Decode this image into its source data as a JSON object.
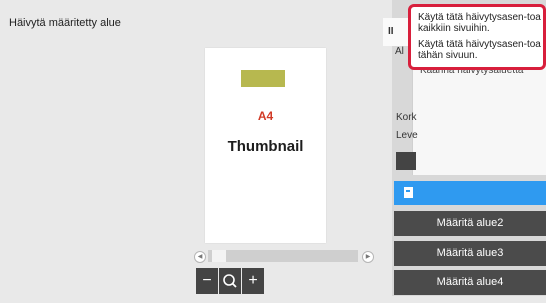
{
  "header": {
    "title": "Häivytä määritetty alue"
  },
  "preview": {
    "highlight_label": "A4",
    "page_label": "Thumbnail"
  },
  "scrollbar": {
    "left_arrow": "◀",
    "right_arrow": "▶"
  },
  "zoom": {
    "minus": "−",
    "search": "🔍",
    "plus": "+"
  },
  "right_panel": {
    "tab_fragment": "II",
    "side_fragment": "Al",
    "behind_item": "Käännä häivytysaluetta",
    "fragment_height": "Kork",
    "fragment_width": "Leve"
  },
  "popup": {
    "item1": "Käytä tätä häivytysasen-toa kaikkiin sivuihin.",
    "item2": "Käytä tätä häivytysasen-toa tähän sivuun."
  },
  "area_buttons": [
    "Määritä alue2",
    "Määritä alue3",
    "Määritä alue4"
  ],
  "colors": {
    "accent_blue": "#2f9af0",
    "popup_border": "#d81f3c"
  }
}
